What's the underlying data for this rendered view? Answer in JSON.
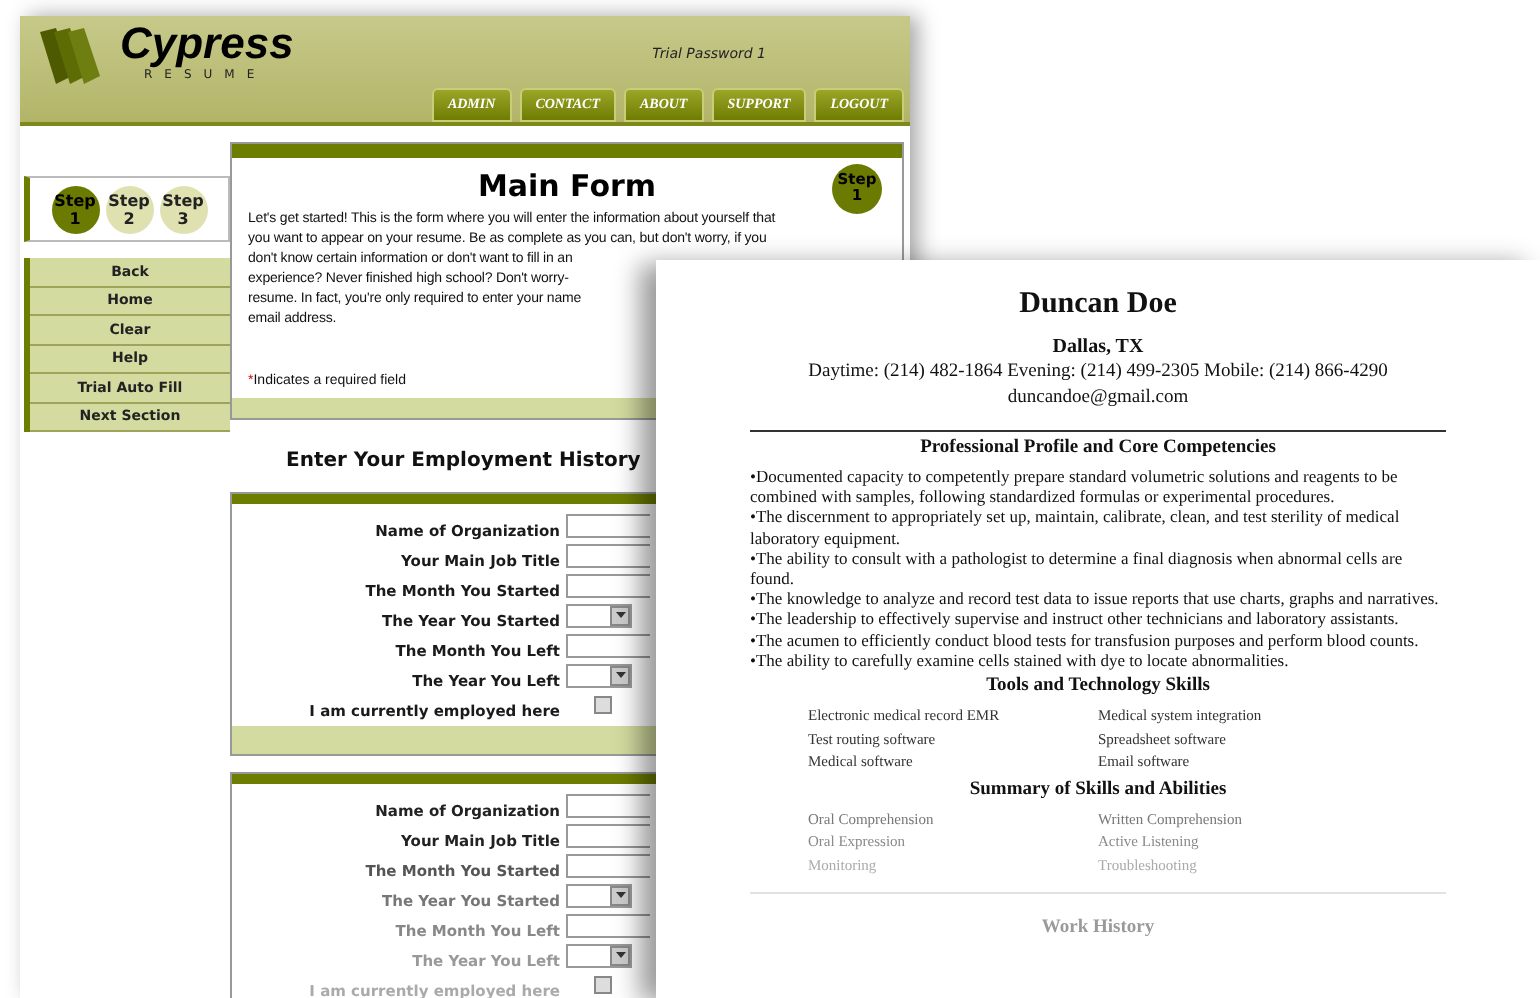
{
  "header": {
    "logo_title": "Cypress",
    "logo_subtitle": "RESUME",
    "user": "Trial Password 1"
  },
  "nav_tabs": [
    {
      "label": "ADMIN"
    },
    {
      "label": "CONTACT"
    },
    {
      "label": "ABOUT"
    },
    {
      "label": "SUPPORT"
    },
    {
      "label": "LOGOUT"
    }
  ],
  "steps": [
    {
      "label": "Step",
      "number": "1",
      "selected": true
    },
    {
      "label": "Step",
      "number": "2",
      "selected": false
    },
    {
      "label": "Step",
      "number": "3",
      "selected": false
    }
  ],
  "sidebar_buttons": [
    "Back",
    "Home",
    "Clear",
    "Help",
    "Trial Auto Fill",
    "Next Section"
  ],
  "main_form": {
    "title": "Main Form",
    "step_badge": {
      "label": "Step",
      "number": "1"
    },
    "intro_lines": [
      "Let's get started! This is the form where you will enter the information about yourself that",
      "you want to appear on your resume. Be as complete as you can, but don't worry, if you",
      "don't know certain information or don't want to fill in an",
      "experience? Never finished high school? Don't worry-",
      "resume. In fact, you're only required to enter your name",
      "email address."
    ],
    "required_note": {
      "mark": "*",
      "text": "Indicates a required field"
    }
  },
  "employment": {
    "heading": "Enter Your Employment History",
    "blocks": [
      {
        "fields": [
          {
            "label": "Name of Organization",
            "kind": "text"
          },
          {
            "label": "Your Main Job Title",
            "kind": "text"
          },
          {
            "label": "The Month You Started",
            "kind": "text"
          },
          {
            "label": "The Year You Started",
            "kind": "select"
          },
          {
            "label": "The Month You Left",
            "kind": "text"
          },
          {
            "label": "The Year You Left",
            "kind": "select"
          },
          {
            "label": "I am currently employed here",
            "kind": "checkbox",
            "checked": false
          }
        ]
      },
      {
        "fields": [
          {
            "label": "Name of Organization",
            "kind": "text"
          },
          {
            "label": "Your Main Job Title",
            "kind": "text"
          },
          {
            "label": "The Month You Started",
            "kind": "text"
          },
          {
            "label": "The Year You Started",
            "kind": "select"
          },
          {
            "label": "The Month You Left",
            "kind": "text"
          },
          {
            "label": "The Year You Left",
            "kind": "select"
          },
          {
            "label": "I am currently employed here",
            "kind": "checkbox",
            "checked": false
          }
        ]
      }
    ]
  },
  "resume": {
    "name": "Duncan Doe",
    "location": "Dallas, TX",
    "phones": "Daytime: (214) 482-1864 Evening: (214) 499-2305 Mobile: (214) 866-4290",
    "email": "duncandoe@gmail.com",
    "sections": [
      {
        "title": "Professional Profile and Core Competencies",
        "kind": "bullets",
        "items": [
          "•Documented capacity to competently prepare standard volumetric solutions and reagents to be combined with samples, following standardized formulas or experimental procedures.",
          "•The discernment to appropriately set up, maintain, calibrate, clean, and test sterility of medical laboratory equipment.",
          "•The ability to consult with a pathologist to determine a final diagnosis when abnormal cells are found.",
          "•The knowledge to analyze and record test data to issue reports that use charts, graphs and narratives.",
          "•The leadership to effectively supervise and instruct other technicians and laboratory assistants.",
          "•The acumen to efficiently conduct blood tests for transfusion purposes and perform blood counts.",
          "•The ability to carefully examine cells stained with dye to locate abnormalities."
        ]
      },
      {
        "title": "Tools and Technology Skills",
        "kind": "columns",
        "items": [
          "Electronic medical record EMR",
          "Medical system integration",
          "Test routing software",
          "Spreadsheet software",
          "Medical software",
          "Email software"
        ]
      },
      {
        "title": "Summary of Skills and Abilities",
        "kind": "columns",
        "items": [
          "Oral Comprehension",
          "Written Comprehension",
          "Oral Expression",
          "Active Listening",
          "Monitoring",
          "Troubleshooting"
        ]
      },
      {
        "title": "Work History",
        "kind": "heading_only"
      }
    ]
  }
}
